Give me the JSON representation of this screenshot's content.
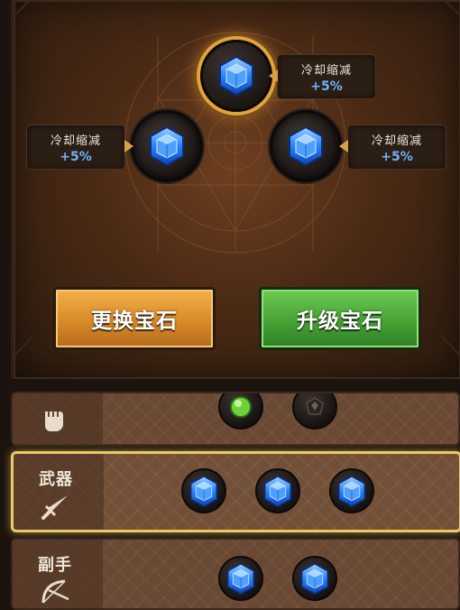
{
  "gem_panel": {
    "slots": [
      {
        "position": "top",
        "gem": "blue-hexagon-gem",
        "selected": true,
        "tooltip": {
          "stat": "冷却缩减",
          "value": "+5%"
        }
      },
      {
        "position": "left",
        "gem": "blue-hexagon-gem",
        "selected": false,
        "tooltip": {
          "stat": "冷却缩减",
          "value": "+5%"
        }
      },
      {
        "position": "right",
        "gem": "blue-hexagon-gem",
        "selected": false,
        "tooltip": {
          "stat": "冷却缩减",
          "value": "+5%"
        }
      }
    ]
  },
  "buttons": {
    "replace_gem": "更换宝石",
    "upgrade_gem": "升级宝石"
  },
  "equipment_rows": [
    {
      "name": "",
      "icon": "fist-icon",
      "gems": [
        "green-gem",
        "dark-gem"
      ],
      "selected": false
    },
    {
      "name": "武器",
      "icon": "sword-icon",
      "gems": [
        "blue-hexagon-gem",
        "blue-hexagon-gem",
        "blue-hexagon-gem"
      ],
      "selected": true
    },
    {
      "name": "副手",
      "icon": "bow-icon",
      "gems": [
        "blue-hexagon-gem",
        "blue-hexagon-gem"
      ],
      "selected": false
    }
  ],
  "colors": {
    "accent_gold": "#e1a33a",
    "gem_blue": "#2f86ff",
    "stat_value": "#6fb1ff",
    "button_orange": "#d88b2a",
    "button_green": "#46a335"
  }
}
